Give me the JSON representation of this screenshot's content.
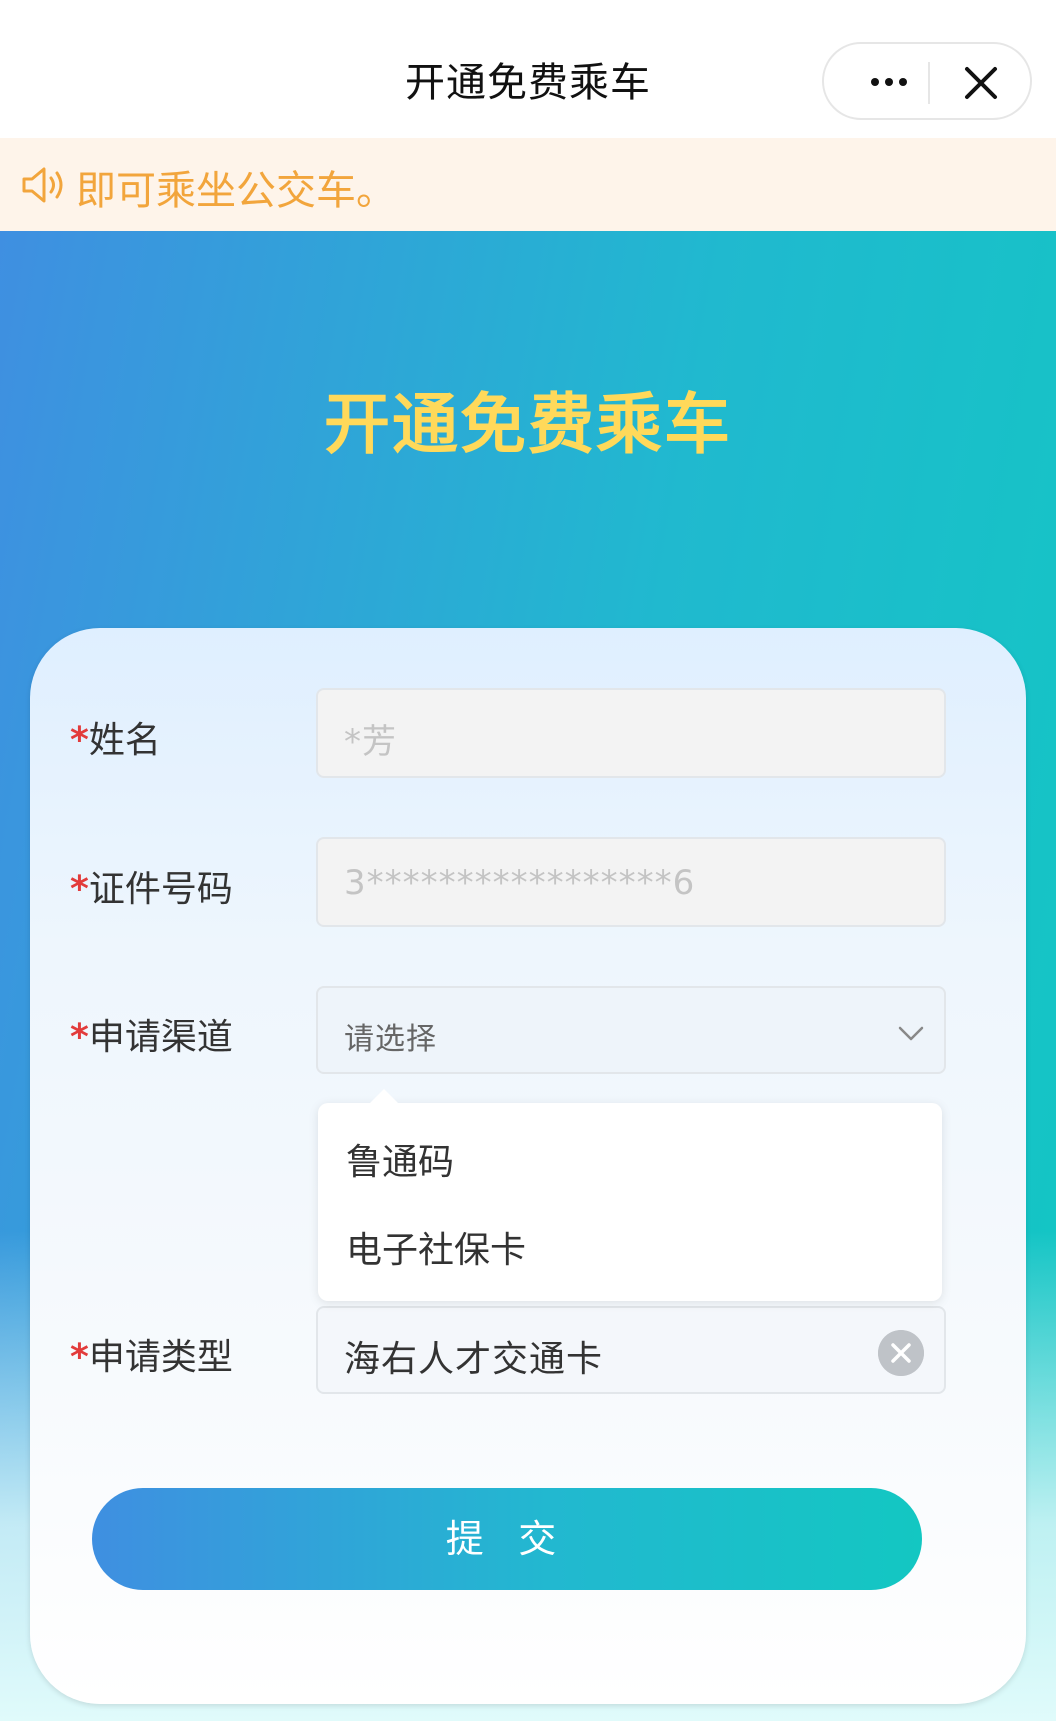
{
  "navbar": {
    "title": "开通免费乘车",
    "more_icon": "more-dots-icon",
    "close_icon": "close-icon"
  },
  "notice": {
    "icon": "speaker-icon",
    "text": "即可乘坐公交车。"
  },
  "hero": {
    "title": "开通免费乘车"
  },
  "form": {
    "name": {
      "star": "*",
      "label": "姓名",
      "value": "*芳"
    },
    "id_number": {
      "star": "*",
      "label": "证件号码",
      "value": "3*****************6"
    },
    "channel": {
      "star": "*",
      "label": "申请渠道",
      "placeholder": "请选择",
      "options": [
        "鲁通码",
        "电子社保卡"
      ]
    },
    "type": {
      "star": "*",
      "label": "申请类型",
      "value": "海右人才交通卡"
    },
    "submit_label": "提 交"
  },
  "colors": {
    "accent_start": "#3f8fe1",
    "accent_end": "#13c7c2",
    "hero_title": "#ffd95a",
    "notice_text": "#f2a53c",
    "required_star": "#e23b3b"
  }
}
